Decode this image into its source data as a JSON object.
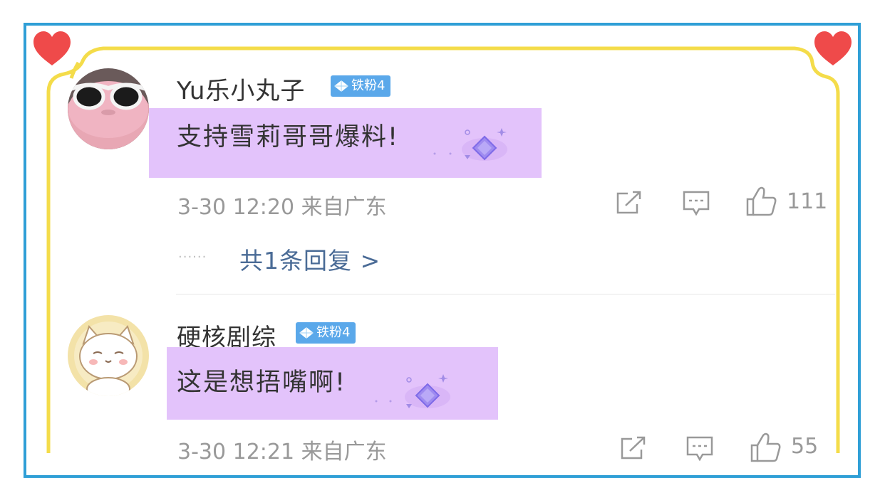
{
  "comments": [
    {
      "username": "Yu乐小丸子",
      "badge": "铁粉4",
      "text": "支持雪莉哥哥爆料!",
      "meta": "3-30 12:20 来自广东",
      "likes": "111",
      "replies": "共1条回复 >",
      "reply_dots": "......"
    },
    {
      "username": "硬核剧综",
      "badge": "铁粉4",
      "text": "这是想捂嘴啊!",
      "meta": "3-30 12:21 来自广东",
      "likes": "55"
    }
  ],
  "colors": {
    "frame_blue": "#2f9fd6",
    "frame_yellow": "#f4dc4a",
    "heart_red": "#ef4a4a",
    "bubble_purple": "#e3c3fb",
    "badge_blue": "#5aa8ea",
    "reply_link": "#4a6b96"
  },
  "icons": [
    "share-icon",
    "comment-icon",
    "thumbs-up-icon",
    "diamond-icon",
    "heart-icon"
  ]
}
